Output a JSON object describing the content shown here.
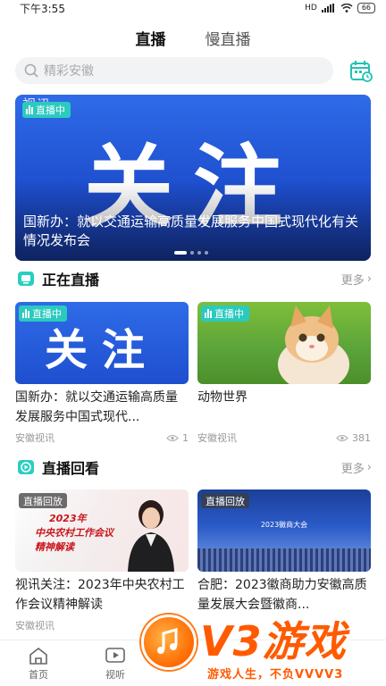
{
  "status_bar": {
    "time": "下午3:55",
    "network": "HD",
    "battery": "66"
  },
  "top_tabs": [
    {
      "label": "直播",
      "active": true
    },
    {
      "label": "慢直播",
      "active": false
    }
  ],
  "search": {
    "placeholder": "精彩安徽"
  },
  "banner": {
    "corner_text": "视讯",
    "badge": "直播中",
    "big_word": "关注",
    "title": "国新办：就以交通运输高质量发展服务中国式现代化有关情况发布会",
    "slides": 4,
    "active_slide": 1
  },
  "live_section": {
    "title": "正在直播",
    "more": "更多",
    "cards": [
      {
        "badge": "直播中",
        "thumb_word": "关注",
        "title": "国新办：就以交通运输高质量发展服务中国式现代...",
        "source": "安徽视讯",
        "views": "1"
      },
      {
        "badge": "直播中",
        "title": "动物世界",
        "source": "安徽视讯",
        "views": "381"
      }
    ]
  },
  "replay_section": {
    "title": "直播回看",
    "more": "更多",
    "cards": [
      {
        "badge": "直播回放",
        "thumb_line1": "2023年",
        "thumb_line2": "中央农村工作会议",
        "thumb_line3": "精神解读",
        "title": "视讯关注：2023年中央农村工作会议精神解读",
        "source": "安徽视讯"
      },
      {
        "badge": "直播回放",
        "thumb_line1": "2023徽商大会",
        "title": "合肥：2023徽商助力安徽高质量发展大会暨徽商...",
        "source": ""
      }
    ]
  },
  "bottom_nav": [
    {
      "label": "首页"
    },
    {
      "label": "视听"
    }
  ],
  "watermark": {
    "title": "V3游戏",
    "slogan": "游戏人生，不负VVVV3"
  },
  "colors": {
    "accent": "#2bcabf",
    "banner_blue": "#1e4fcf",
    "watermark_orange": "#ff5a00"
  }
}
